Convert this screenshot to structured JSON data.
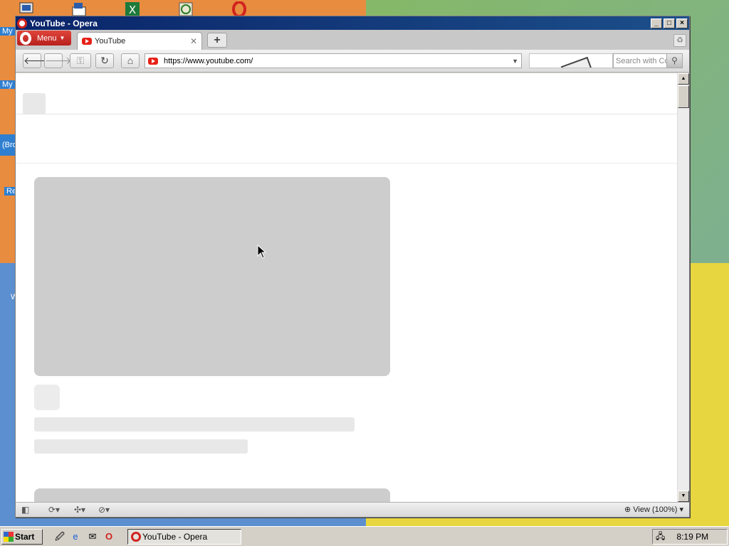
{
  "desktop": {
    "labels": [
      "My",
      "My I",
      "(Bro",
      "Re",
      "W"
    ]
  },
  "window": {
    "title": "YouTube - Opera",
    "menu_label": "Menu",
    "tab": {
      "label": "YouTube"
    }
  },
  "address": {
    "url": "https://www.youtube.com/",
    "search_placeholder": "Search with Co"
  },
  "status": {
    "view_label": "View (100%)"
  },
  "taskbar": {
    "start_label": "Start",
    "task_label": "YouTube - Opera",
    "clock": "8:19 PM"
  }
}
